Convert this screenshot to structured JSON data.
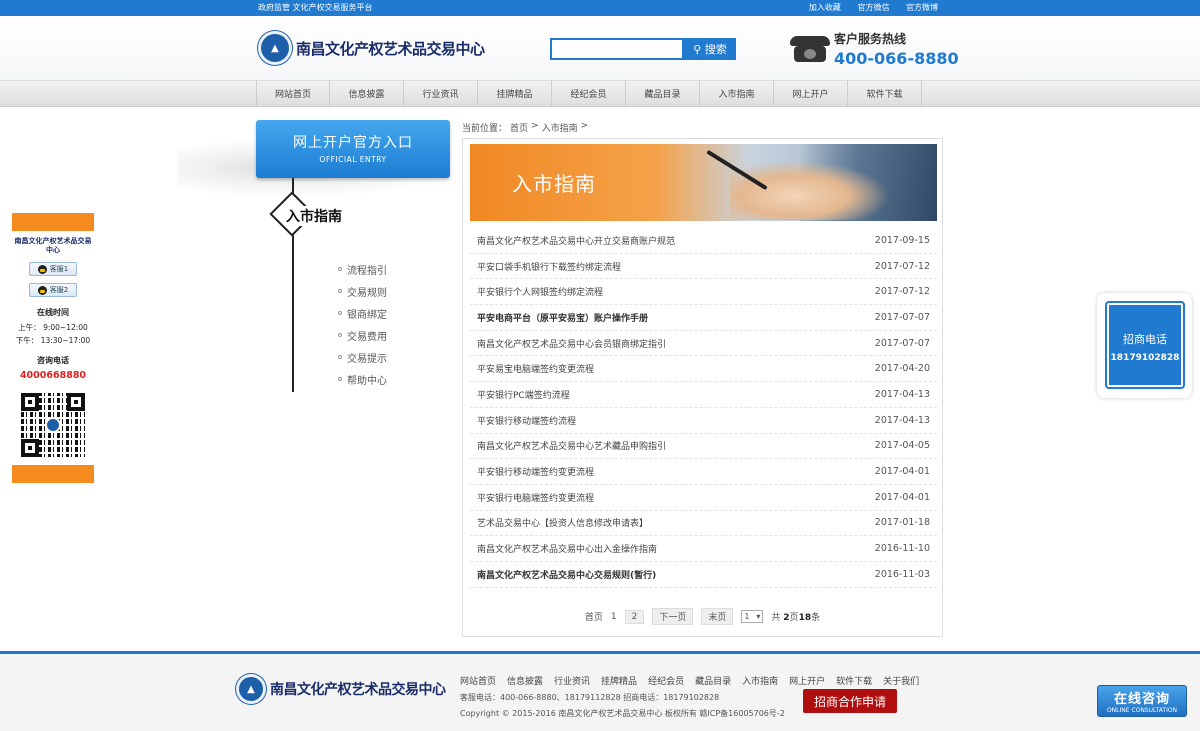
{
  "topbar": {
    "left_text": "政府监管 文化产权交易服务平台",
    "links": [
      "加入收藏",
      "官方微信",
      "官方微博"
    ]
  },
  "header": {
    "logo_text": "南昌文化产权艺术品交易中心",
    "search": {
      "placeholder": "",
      "button_label": "搜索"
    },
    "hotline_label": "客户服务热线",
    "hotline_number": "400-066-8880"
  },
  "nav": {
    "items": [
      "网站首页",
      "信息披露",
      "行业资讯",
      "挂牌精品",
      "经纪会员",
      "藏品目录",
      "入市指南",
      "网上开户",
      "软件下载"
    ]
  },
  "left_panel": {
    "logo_text": "南昌文化产权艺术品交易中心",
    "qq1": "客服1",
    "qq2": "客服2",
    "online_time_title": "在线时间",
    "time_am": "上午：  9:00~12:00",
    "time_pm": "下午：  13:30~17:00",
    "phone_label": "咨询电话",
    "phone": "4000668880"
  },
  "sidebar": {
    "entry_cn": "网上开户官方入口",
    "entry_en": "OFFICIAL ENTRY",
    "title": "入市指南",
    "items": [
      "流程指引",
      "交易规则",
      "银商绑定",
      "交易费用",
      "交易提示",
      "帮助中心"
    ]
  },
  "breadcrumb": {
    "prefix": "当前位置：",
    "home": "首页",
    "sep": ">",
    "current": "入市指南",
    "end": ">"
  },
  "banner": {
    "title": "入市指南"
  },
  "articles": [
    {
      "title": "南昌文化产权艺术品交易中心开立交易商账户规范",
      "date": "2017-09-15",
      "bold": false
    },
    {
      "title": "平安口袋手机银行下载签约绑定流程",
      "date": "2017-07-12",
      "bold": false
    },
    {
      "title": "平安银行个人网银签约绑定流程",
      "date": "2017-07-12",
      "bold": false
    },
    {
      "title": "平安电商平台（原平安易宝）账户操作手册",
      "date": "2017-07-07",
      "bold": true
    },
    {
      "title": "南昌文化产权艺术品交易中心会员银商绑定指引",
      "date": "2017-07-07",
      "bold": false
    },
    {
      "title": "平安易宝电脑端签约变更流程",
      "date": "2017-04-20",
      "bold": false
    },
    {
      "title": "平安银行PC端签约流程",
      "date": "2017-04-13",
      "bold": false
    },
    {
      "title": "平安银行移动端签约流程",
      "date": "2017-04-13",
      "bold": false
    },
    {
      "title": "南昌文化产权艺术品交易中心艺术藏品申购指引",
      "date": "2017-04-05",
      "bold": false
    },
    {
      "title": "平安银行移动端签约变更流程",
      "date": "2017-04-01",
      "bold": false
    },
    {
      "title": "平安银行电脑端签约变更流程",
      "date": "2017-04-01",
      "bold": false
    },
    {
      "title": "艺术品交易中心【投资人信息修改申请表】",
      "date": "2017-01-18",
      "bold": false
    },
    {
      "title": "南昌文化产权艺术品交易中心出入金操作指南",
      "date": "2016-11-10",
      "bold": false
    },
    {
      "title": "南昌文化产权艺术品交易中心交易规则(暂行)",
      "date": "2016-11-03",
      "bold": true
    }
  ],
  "pager": {
    "first": "首页",
    "page1": "1",
    "page2": "2",
    "next": "下一页",
    "last": "末页",
    "select_value": "1",
    "total_prefix": "共",
    "total_pages": "2",
    "pages_suffix": "页",
    "total_items": "18",
    "items_suffix": "条"
  },
  "right_float": {
    "title": "招商电话",
    "number": "18179102828"
  },
  "footer": {
    "logo_text": "南昌文化产权艺术品交易中心",
    "links": [
      "网站首页",
      "信息披露",
      "行业资讯",
      "挂牌精品",
      "经纪会员",
      "藏品目录",
      "入市指南",
      "网上开户",
      "软件下载",
      "关于我们"
    ],
    "contact": "客服电话：400-066-8880、18179112828 招商电话：18179102828",
    "copyright": "Copyright © 2015-2016 南昌文化产权艺术品交易中心 板权所有 赣ICP备16005706号-2",
    "apply_button": "招商合作申请"
  },
  "online_consult": {
    "cn": "在线咨询",
    "en": "ONLINE CONSULTATION"
  },
  "colors": {
    "brand_blue": "#1f7ad0",
    "orange": "#f58b1e",
    "red": "#e02020",
    "footer_red": "#b10f0f"
  }
}
